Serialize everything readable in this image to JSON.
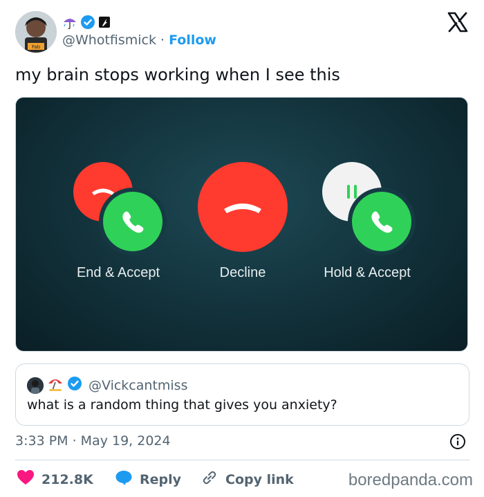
{
  "user": {
    "handle": "@Whotfismick",
    "separator": "·",
    "follow_label": "Follow",
    "avatar_text": "Fab",
    "icons": [
      "umbrella-rain-icon",
      "verified-badge-icon",
      "affiliate-badge-icon"
    ]
  },
  "tweet": {
    "text": "my brain stops working when I see this"
  },
  "media": {
    "buttons": [
      {
        "label": "End & Accept",
        "color": "#ff3b2f"
      },
      {
        "label": "Decline",
        "color": "#ff3b2f"
      },
      {
        "label": "Hold & Accept",
        "color": "#30d158"
      }
    ]
  },
  "quote": {
    "handle": "@Vickcantmiss",
    "text": "what is a random thing that gives you anxiety?"
  },
  "meta": {
    "timestamp": "3:33 PM · May 19, 2024"
  },
  "actions": {
    "likes": "212.8K",
    "reply": "Reply",
    "copy_link": "Copy link"
  },
  "watermark": "boredpanda.com",
  "colors": {
    "accent": "#1d9bf0",
    "like": "#f91880",
    "decline_red": "#ff3b2f",
    "accept_green": "#30d158"
  }
}
